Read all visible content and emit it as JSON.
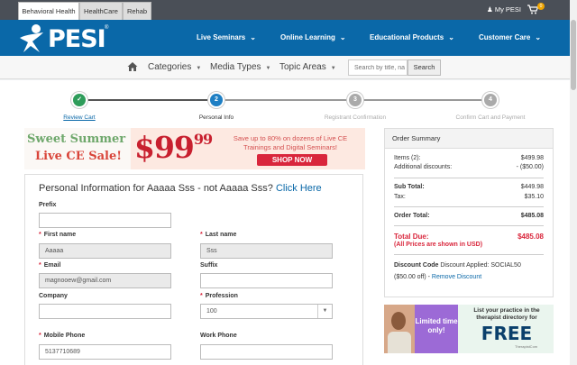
{
  "top_tabs": [
    "Behavioral Health",
    "HealthCare",
    "Rehab"
  ],
  "account": {
    "label": "My PESI",
    "cart_count": "0"
  },
  "brand": {
    "name": "PESI",
    "reg": "®"
  },
  "main_nav": [
    "Live Seminars",
    "Online Learning",
    "Educational Products",
    "Customer Care"
  ],
  "sub_nav": [
    "Categories",
    "Media Types",
    "Topic Areas"
  ],
  "search": {
    "placeholder": "Search by title, na",
    "button": "Search"
  },
  "steps": [
    {
      "num": "2",
      "label": "Personal Info"
    },
    {
      "num": "3",
      "label": "Registrant Confirmation"
    },
    {
      "num": "4",
      "label": "Confirm Cart and Payment"
    }
  ],
  "step_done": {
    "label": "Review Cart"
  },
  "banner": {
    "line1": "Sweet Summer",
    "line2": "Live CE Sale!",
    "price": "$99",
    "cents": "99",
    "promo": "Save up to 80% on dozens of Live CE Trainings and Digital Seminars!",
    "cta": "SHOP NOW"
  },
  "form": {
    "title": "Personal Information for Aaaaa Sss - not Aaaaa Sss?",
    "title_link": "Click Here",
    "prefix_label": "Prefix",
    "first_label": "First name",
    "first_value": "Aaaaa",
    "last_label": "Last name",
    "last_value": "Sss",
    "email_label": "Email",
    "email_value": "magnooew@gmail.com",
    "suffix_label": "Suffix",
    "company_label": "Company",
    "profession_label": "Profession",
    "profession_value": "100",
    "mobile_label": "Mobile Phone",
    "mobile_value": "5137710689",
    "work_label": "Work Phone"
  },
  "summary": {
    "title": "Order Summary",
    "items_label": "Items (2):",
    "items_value": "$499.98",
    "disc_label": "Additional discounts:",
    "disc_value": "- ($50.00)",
    "subtotal_label": "Sub Total:",
    "subtotal_value": "$449.98",
    "tax_label": "Tax:",
    "tax_value": "$35.10",
    "total_label": "Order Total:",
    "total_value": "$485.08",
    "due_label": "Total Due:",
    "due_value": "$485.08",
    "usd_note": "(All Prices are shown in USD)",
    "code_label": "Discount Code",
    "code_text": "Discount Applied: SOCIAL50",
    "code_amount": "($50.00 off) -",
    "remove": "Remove Discount"
  },
  "ad": {
    "badge": "Limited time only!",
    "headline": "List your practice in the therapist directory for",
    "free": "FREE",
    "brand": "TherapistCom"
  },
  "colors": {
    "primary": "#0a68a8",
    "accent_red": "#d9263c",
    "step_done": "#2e9c5a",
    "step_pending": "#aaaaaa"
  }
}
